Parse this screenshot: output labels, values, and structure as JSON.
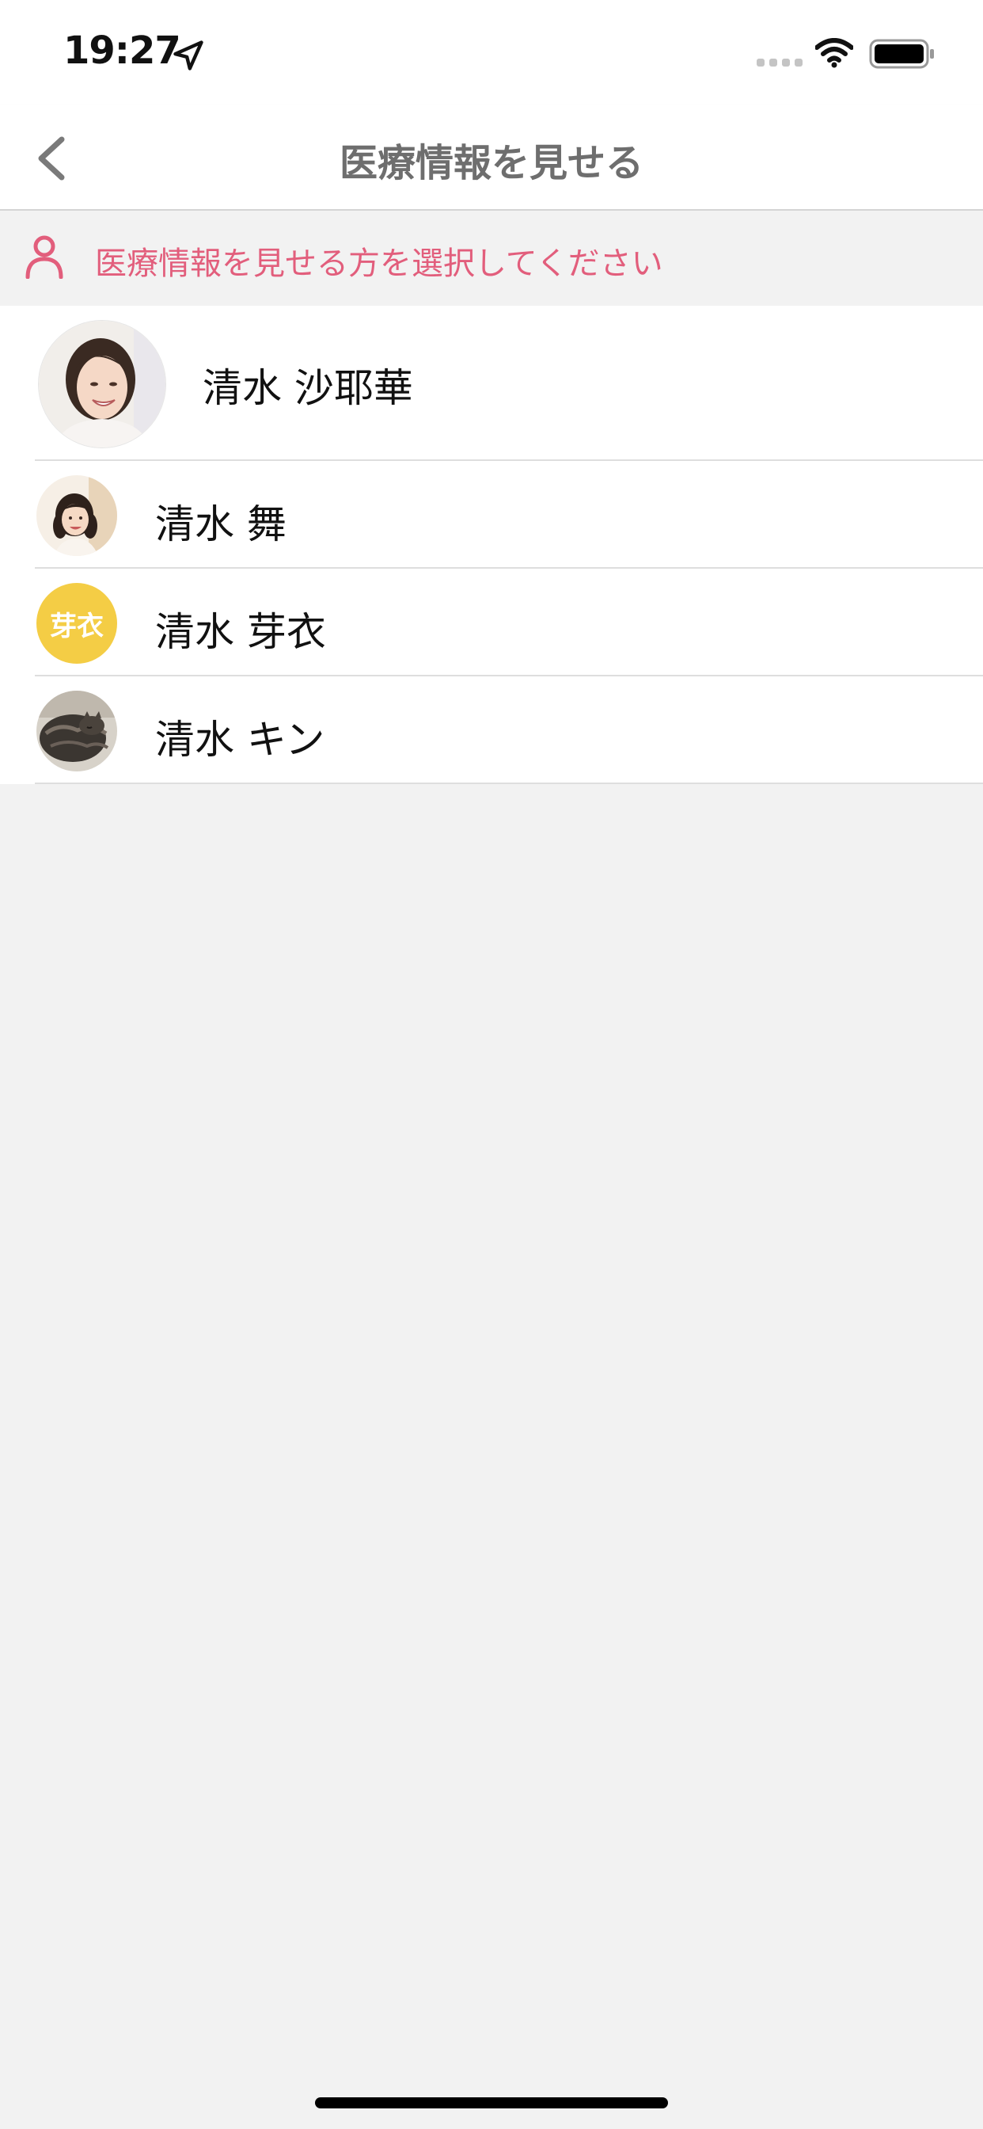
{
  "status_bar": {
    "time": "19:27",
    "location_icon": "location-arrow-icon",
    "signal_icon": "cellular-signal-icon",
    "wifi_icon": "wifi-icon",
    "battery_icon": "battery-icon"
  },
  "nav": {
    "back_icon": "chevron-left-icon",
    "title": "医療情報を見せる"
  },
  "prompt": {
    "icon": "person-icon",
    "text": "医療情報を見せる方を選択してください",
    "color": "#e25e7c"
  },
  "members": [
    {
      "name": "清水 沙耶華",
      "avatar": "photo-woman"
    },
    {
      "name": "清水 舞",
      "avatar": "photo-child"
    },
    {
      "name": "清水 芽衣",
      "avatar_text": "芽衣",
      "avatar_color": "#f4cd45"
    },
    {
      "name": "清水 キン",
      "avatar": "photo-cat"
    }
  ]
}
